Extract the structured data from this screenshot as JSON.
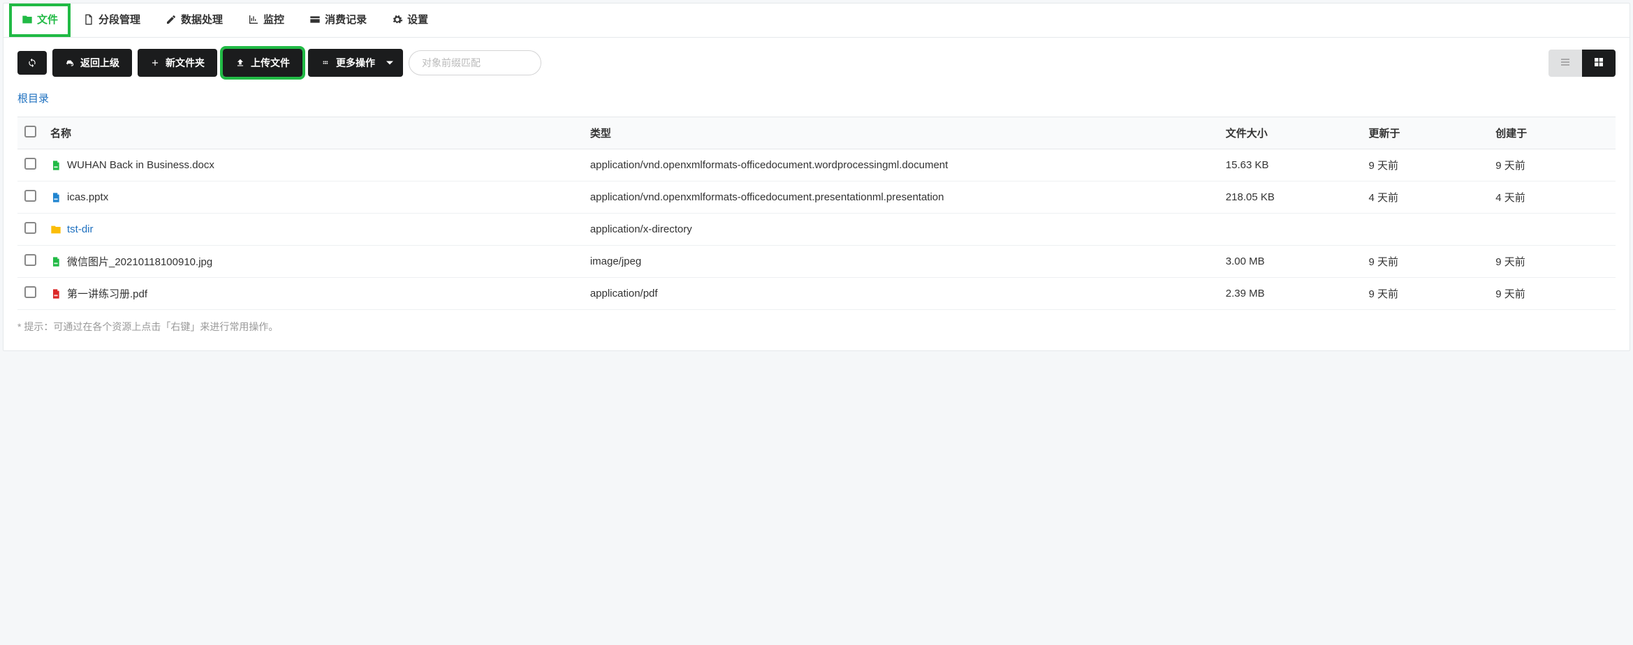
{
  "tabs": [
    {
      "label": "文件",
      "icon": "folder"
    },
    {
      "label": "分段管理",
      "icon": "document"
    },
    {
      "label": "数据处理",
      "icon": "edit"
    },
    {
      "label": "监控",
      "icon": "chart"
    },
    {
      "label": "消费记录",
      "icon": "card"
    },
    {
      "label": "设置",
      "icon": "gear"
    }
  ],
  "toolbar": {
    "refresh_label": "",
    "back_label": "返回上级",
    "new_folder_label": "新文件夹",
    "upload_label": "上传文件",
    "more_label": "更多操作",
    "search_placeholder": "对象前缀匹配"
  },
  "breadcrumb": {
    "root_label": "根目录"
  },
  "columns": {
    "name": "名称",
    "type": "类型",
    "size": "文件大小",
    "updated": "更新于",
    "created": "创建于"
  },
  "files": [
    {
      "name": "WUHAN Back in Business.docx",
      "type": "application/vnd.openxmlformats-officedocument.wordprocessingml.document",
      "size": "15.63 KB",
      "updated": "9 天前",
      "created": "9 天前",
      "icon_color": "#21ba45",
      "is_folder": false
    },
    {
      "name": "icas.pptx",
      "type": "application/vnd.openxmlformats-officedocument.presentationml.presentation",
      "size": "218.05 KB",
      "updated": "4 天前",
      "created": "4 天前",
      "icon_color": "#2185d0",
      "is_folder": false
    },
    {
      "name": "tst-dir",
      "type": "application/x-directory",
      "size": "",
      "updated": "",
      "created": "",
      "icon_color": "#fbbd08",
      "is_folder": true
    },
    {
      "name": "微信图片_20210118100910.jpg",
      "type": "image/jpeg",
      "size": "3.00 MB",
      "updated": "9 天前",
      "created": "9 天前",
      "icon_color": "#21ba45",
      "is_folder": false
    },
    {
      "name": "第一讲练习册.pdf",
      "type": "application/pdf",
      "size": "2.39 MB",
      "updated": "9 天前",
      "created": "9 天前",
      "icon_color": "#db2828",
      "is_folder": false
    }
  ],
  "hint": "* 提示：可通过在各个资源上点击「右键」来进行常用操作。",
  "active_tab_index": 0,
  "highlight_tab_index": 0,
  "highlight_button": "upload",
  "view_mode": "grid"
}
